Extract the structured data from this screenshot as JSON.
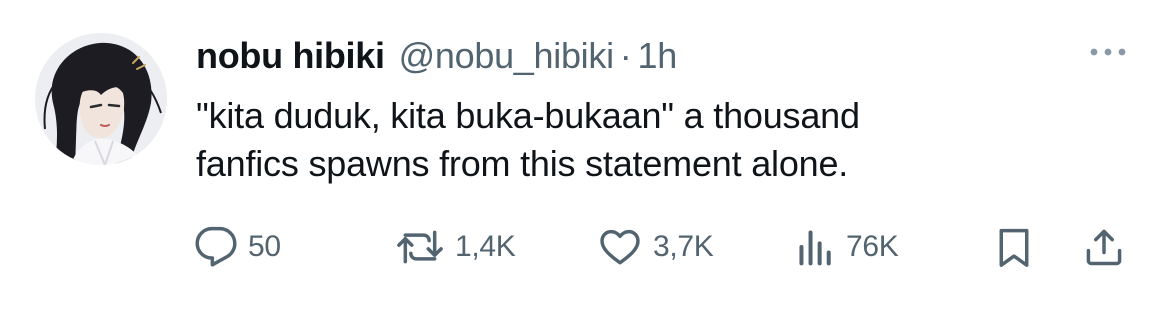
{
  "tweet": {
    "display_name": "nobu hibiki",
    "handle": "@nobu_hibiki",
    "separator": "·",
    "time": "1h",
    "text": "\"kita duduk, kita buka-bukaan\" a thousand\nfanfics spawns from this statement alone.",
    "avatar_icon": "profile-avatar"
  },
  "actions": {
    "reply": {
      "icon": "reply-icon",
      "count": "50"
    },
    "repost": {
      "icon": "repost-icon",
      "count": "1,4K"
    },
    "like": {
      "icon": "heart-icon",
      "count": "3,7K"
    },
    "views": {
      "icon": "views-icon",
      "count": "76K"
    },
    "bookmark": {
      "icon": "bookmark-icon"
    },
    "share": {
      "icon": "share-icon"
    }
  },
  "colors": {
    "text_primary": "#0f1419",
    "text_secondary": "#536471",
    "background": "#ffffff"
  }
}
